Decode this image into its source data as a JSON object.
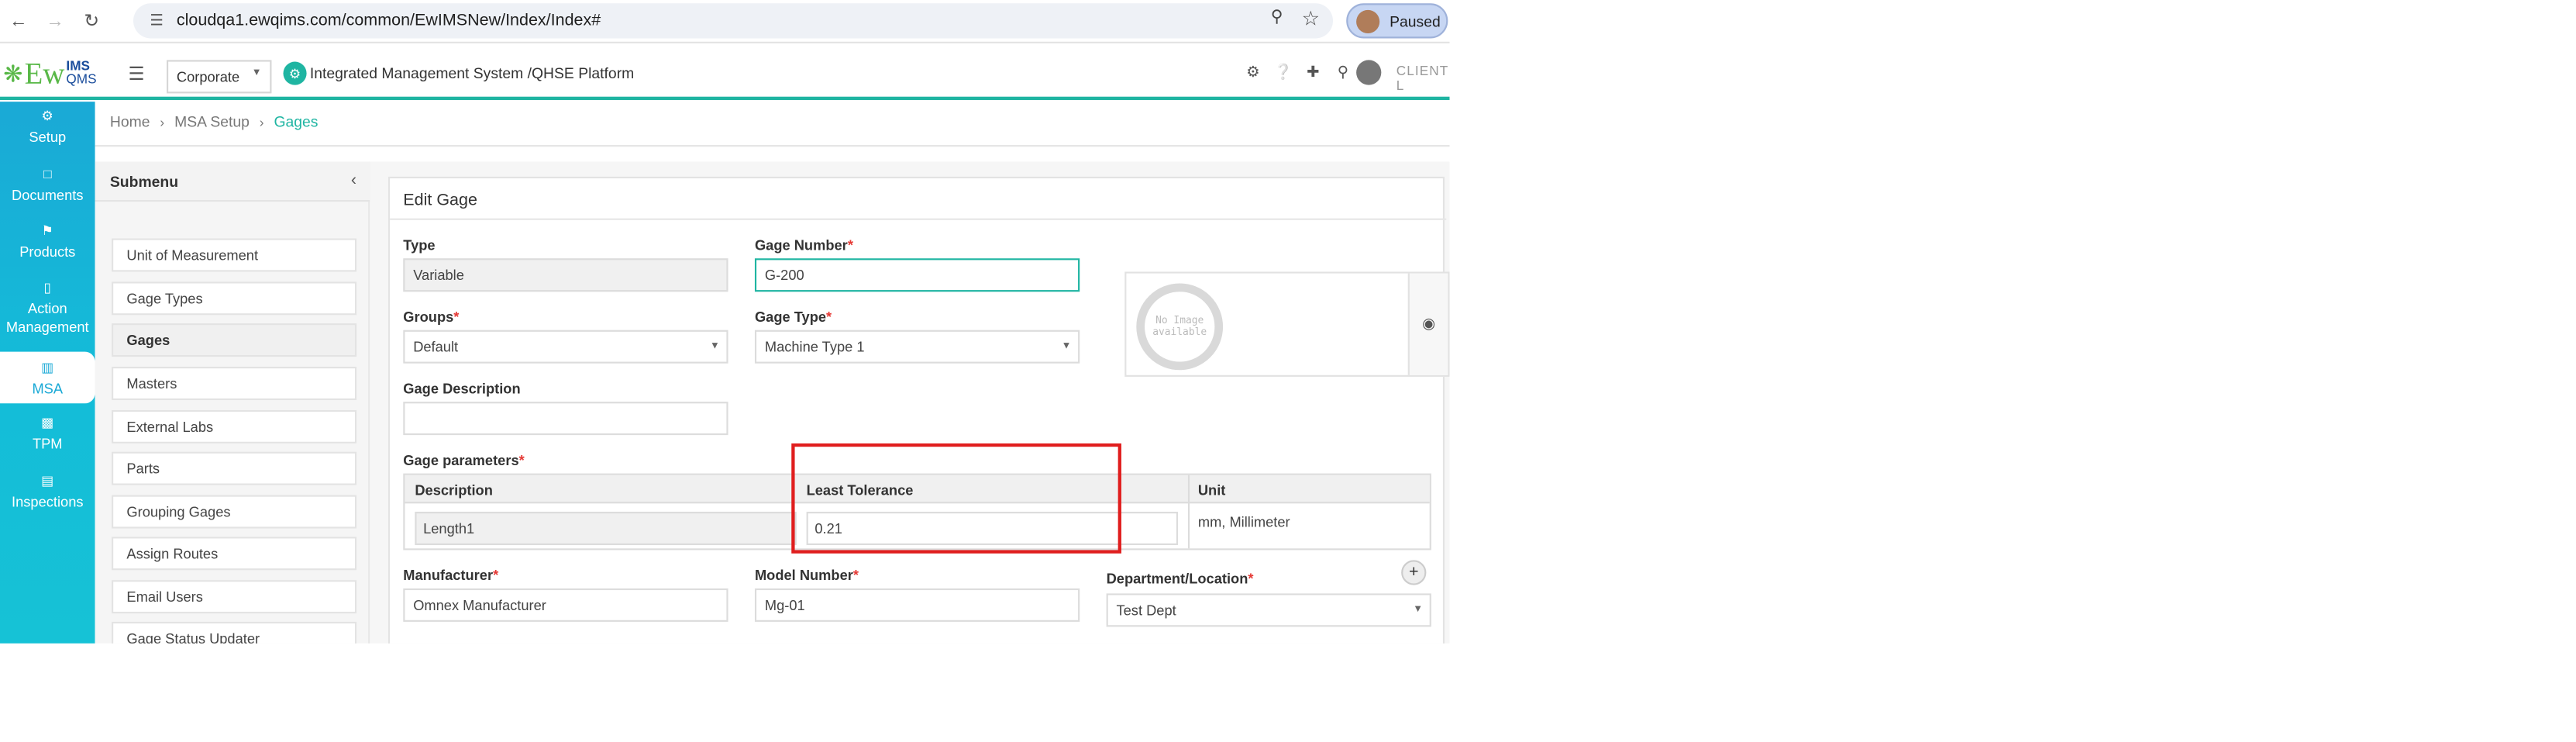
{
  "browser": {
    "url": "cloudqa1.ewqims.com/common/EwIMSNew/Index/Index#",
    "profile_status": "Paused"
  },
  "header": {
    "logo_ew": "Ew",
    "logo_ims": "IMS",
    "logo_qms": "QMS",
    "corporate": "Corporate",
    "platform_title": "Integrated Management System /QHSE Platform",
    "client_label": "CLIENT L"
  },
  "leftnav": [
    {
      "label": "Setup",
      "icon": "gears-icon"
    },
    {
      "label": "Documents",
      "icon": "document-icon"
    },
    {
      "label": "Products",
      "icon": "flag-icon"
    },
    {
      "label": "Action Management",
      "icon": "mobile-icon"
    },
    {
      "label": "MSA",
      "icon": "bar-chart-icon"
    },
    {
      "label": "TPM",
      "icon": "truck-icon"
    },
    {
      "label": "Inspections",
      "icon": "inspection-icon"
    }
  ],
  "breadcrumb": {
    "home": "Home",
    "setup": "MSA Setup",
    "current": "Gages"
  },
  "submenu": {
    "title": "Submenu",
    "items": [
      "Unit of Measurement",
      "Gage Types",
      "Gages",
      "Masters",
      "External Labs",
      "Parts",
      "Grouping Gages",
      "Assign Routes",
      "Email Users",
      "Gage Status Updater"
    ]
  },
  "form": {
    "title": "Edit Gage",
    "type_label": "Type",
    "type_value": "Variable",
    "gage_number_label": "Gage Number",
    "gage_number_value": "G-200",
    "groups_label": "Groups",
    "groups_value": "Default",
    "gage_type_label": "Gage Type",
    "gage_type_value": "Machine Type 1",
    "description_label": "Gage Description",
    "description_value": "",
    "no_image_text": "No Image available",
    "params_label": "Gage parameters",
    "params_headers": [
      "Description",
      "Least Tolerance",
      "Unit"
    ],
    "params_row": {
      "description": "Length1",
      "least_tolerance": "0.21",
      "unit": "mm, Millimeter"
    },
    "manufacturer_label": "Manufacturer",
    "manufacturer_value": "Omnex Manufacturer",
    "model_label": "Model Number",
    "model_value": "Mg-01",
    "dept_label": "Department/Location",
    "dept_value": "Test Dept",
    "required_mark": "*"
  },
  "colors": {
    "accent": "#1fb5a2",
    "nav": "#1aa9d6",
    "highlight": "#e01e1e"
  }
}
